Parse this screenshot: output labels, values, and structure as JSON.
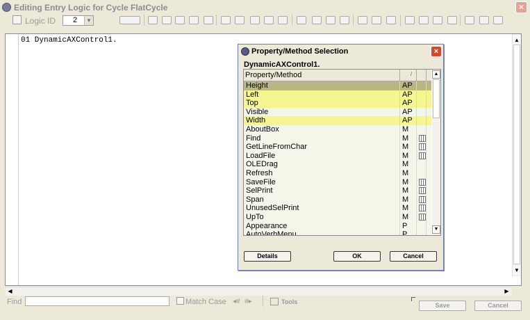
{
  "window": {
    "title": "Editing Entry Logic for Cycle FlatCycle",
    "close_label": "×"
  },
  "toolbar": {
    "logic_id_label": "Logic ID",
    "logic_id_value": "2",
    "icons": [
      "grid-icon",
      "spell-icon",
      "cut-icon",
      "copy-icon",
      "paste-icon",
      "find-icon",
      "replace-icon",
      "undo-icon",
      "redo-icon",
      "indent-icon",
      "outdent-icon",
      "comment-icon",
      "uncomment-icon",
      "print-icon",
      "page-icon",
      "help-icon",
      "compile-icon",
      "run-icon",
      "stop-icon",
      "save-icon",
      "reload-icon",
      "check-icon",
      "back-icon",
      "forward-icon",
      "zoom-icon"
    ]
  },
  "editor": {
    "line1": "01 DynamicAXControl1."
  },
  "bottom": {
    "find_label": "Find",
    "find_value": "",
    "match_case_label": "Match Case",
    "tools_label": "Tools",
    "save_label": "Save",
    "cancel_label": "Cancel"
  },
  "dialog": {
    "title": "Property/Method Selection",
    "close_label": "×",
    "object_name": "DynamicAXControl1.",
    "col_name": "Property/Method",
    "col_type": "/",
    "rows": [
      {
        "name": "Height",
        "type": "AP",
        "state": "selected",
        "book": false
      },
      {
        "name": "Left",
        "type": "AP",
        "state": "highlight",
        "book": false
      },
      {
        "name": "Top",
        "type": "AP",
        "state": "highlight",
        "book": false
      },
      {
        "name": "Visible",
        "type": "AP",
        "state": "normal",
        "book": false
      },
      {
        "name": "Width",
        "type": "AP",
        "state": "highlight",
        "book": false
      },
      {
        "name": "AboutBox",
        "type": "M",
        "state": "normal",
        "book": false
      },
      {
        "name": "Find",
        "type": "M",
        "state": "normal",
        "book": true
      },
      {
        "name": "GetLineFromChar",
        "type": "M",
        "state": "normal",
        "book": true
      },
      {
        "name": "LoadFile",
        "type": "M",
        "state": "normal",
        "book": true
      },
      {
        "name": "OLEDrag",
        "type": "M",
        "state": "normal",
        "book": false
      },
      {
        "name": "Refresh",
        "type": "M",
        "state": "normal",
        "book": false
      },
      {
        "name": "SaveFile",
        "type": "M",
        "state": "normal",
        "book": true
      },
      {
        "name": "SelPrint",
        "type": "M",
        "state": "normal",
        "book": true
      },
      {
        "name": "Span",
        "type": "M",
        "state": "normal",
        "book": true
      },
      {
        "name": "UnusedSelPrint",
        "type": "M",
        "state": "normal",
        "book": true
      },
      {
        "name": "UpTo",
        "type": "M",
        "state": "normal",
        "book": true
      },
      {
        "name": "Appearance",
        "type": "P",
        "state": "normal",
        "book": false
      },
      {
        "name": "AutoVerbMenu",
        "type": "P",
        "state": "normal",
        "book": false
      }
    ],
    "details_label": "Details",
    "ok_label": "OK",
    "cancel_label": "Cancel"
  }
}
